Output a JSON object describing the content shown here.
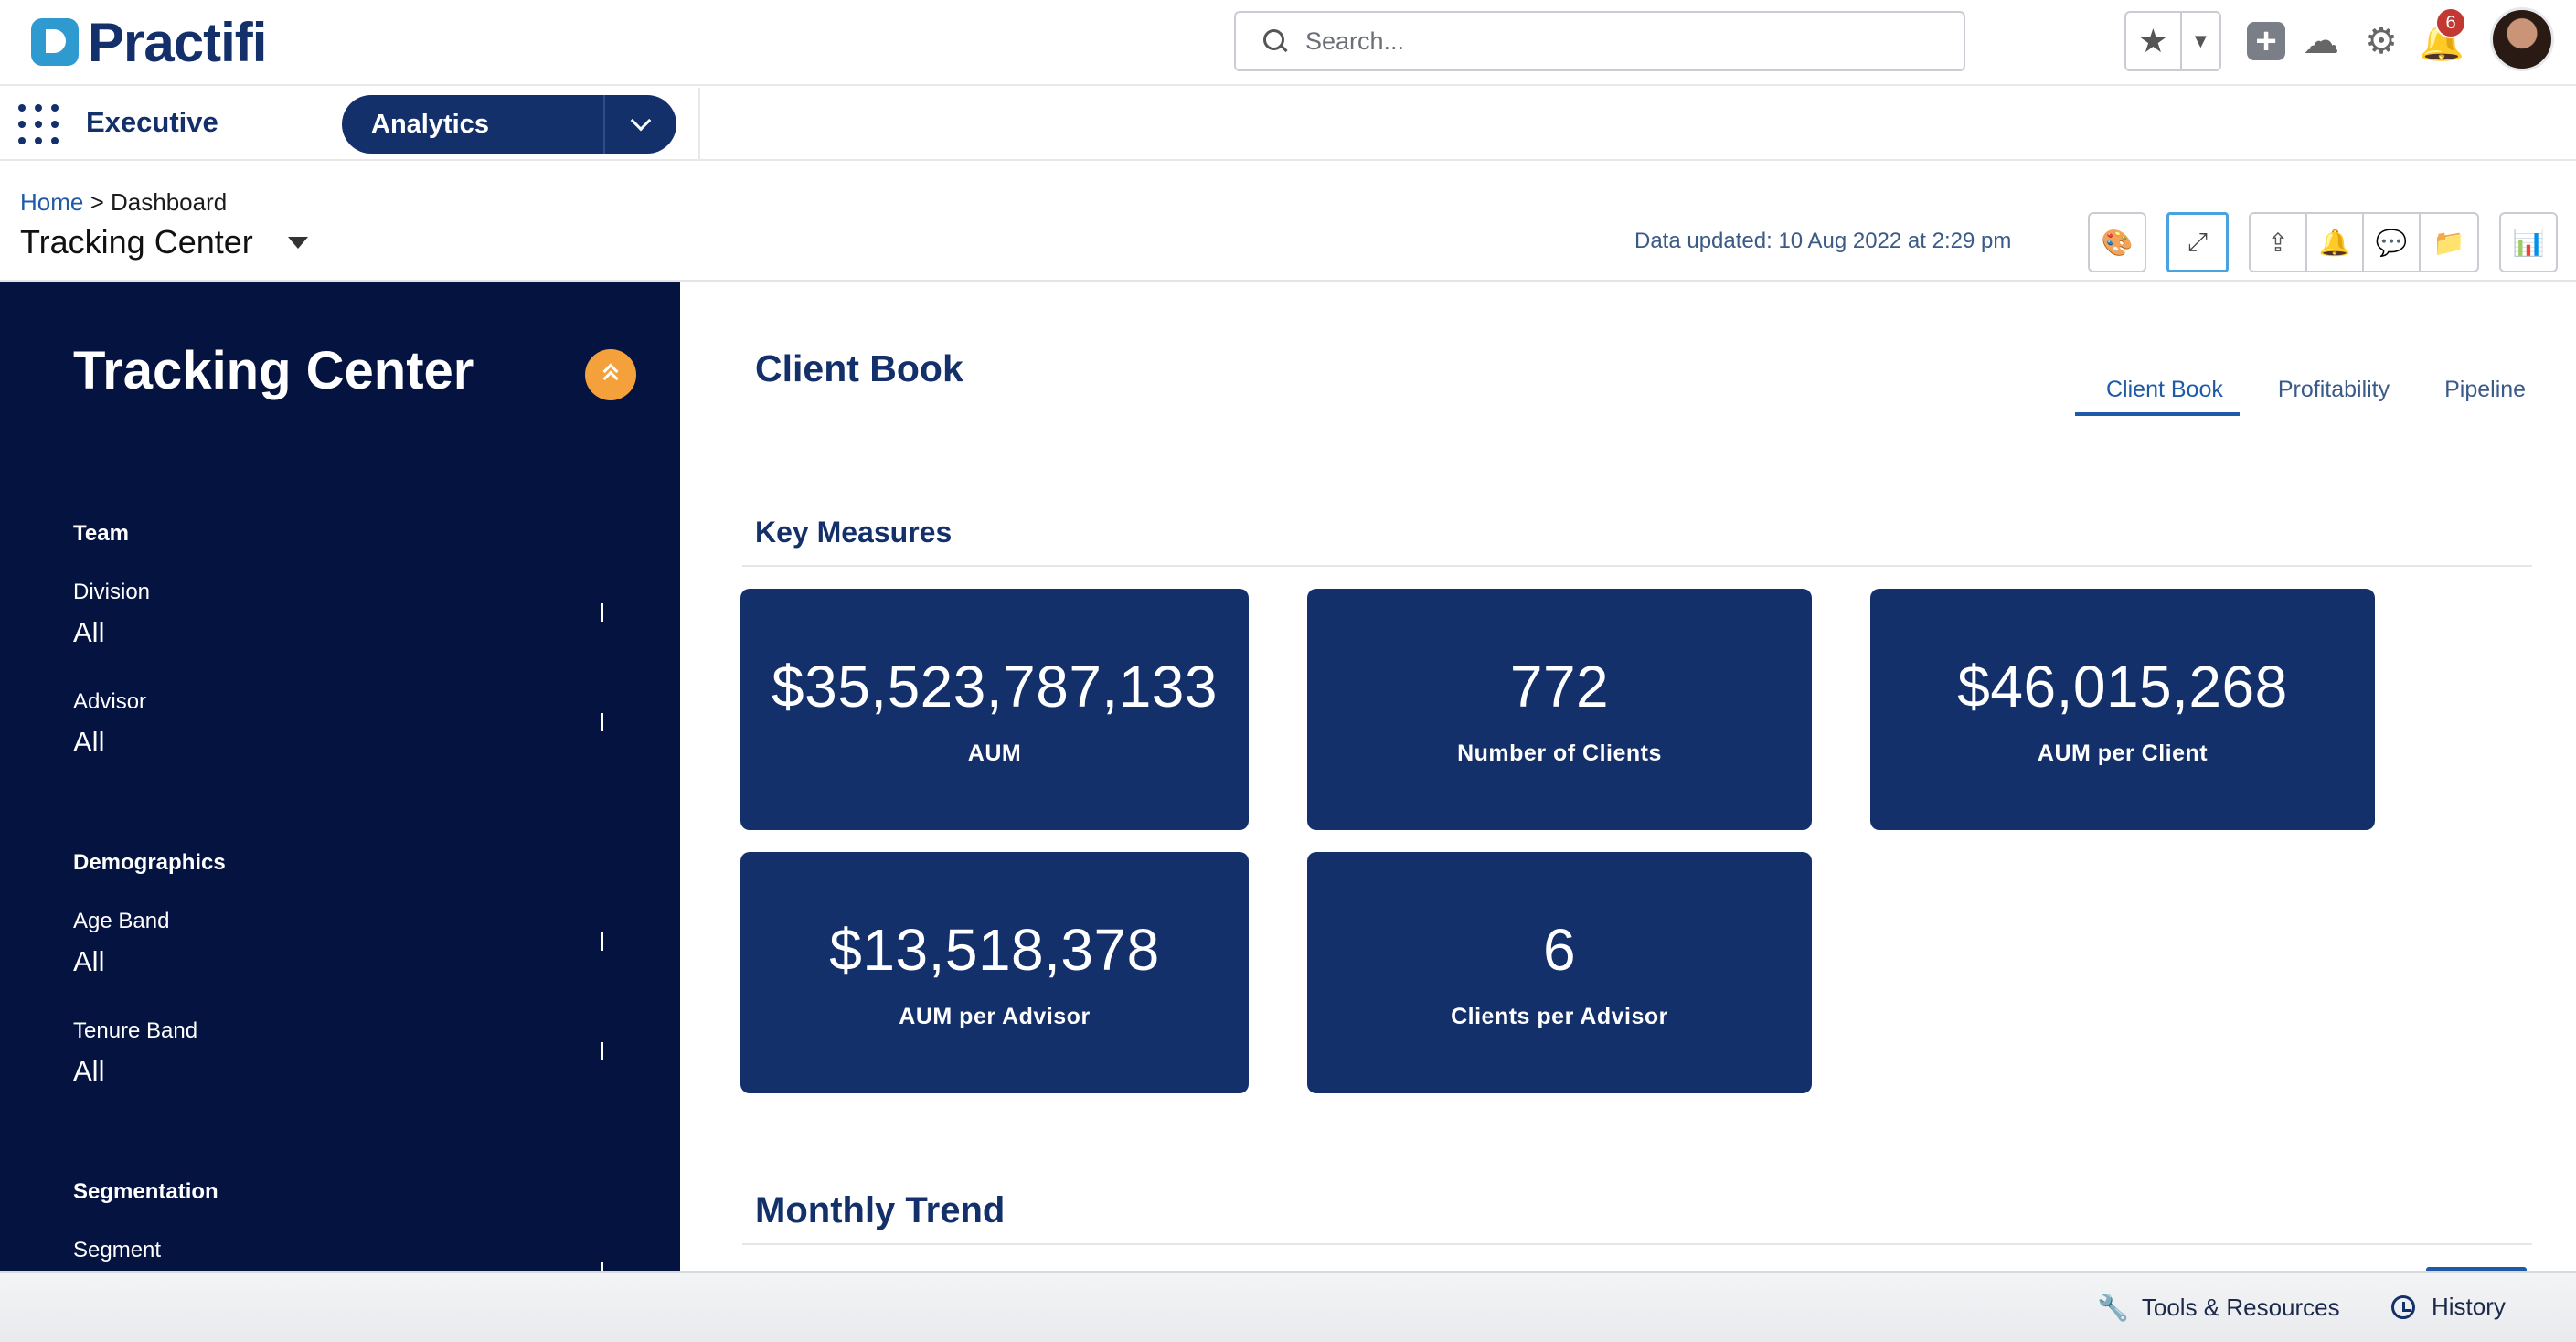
{
  "header": {
    "logo_text": "Practifi",
    "search_placeholder": "Search...",
    "notification_count": "6"
  },
  "nav": {
    "app_name": "Executive",
    "tab_label": "Analytics"
  },
  "page": {
    "breadcrumb_home": "Home",
    "breadcrumb_separator": ">",
    "breadcrumb_current": "Dashboard",
    "title": "Tracking Center",
    "data_updated": "Data updated: 10 Aug 2022 at 2:29 pm"
  },
  "sidebar": {
    "title": "Tracking Center",
    "sections": [
      {
        "title": "Team",
        "filters": [
          {
            "label": "Division",
            "value": "All"
          },
          {
            "label": "Advisor",
            "value": "All"
          }
        ]
      },
      {
        "title": "Demographics",
        "filters": [
          {
            "label": "Age Band",
            "value": "All"
          },
          {
            "label": "Tenure Band",
            "value": "All"
          }
        ]
      },
      {
        "title": "Segmentation",
        "filters": [
          {
            "label": "Segment",
            "value": ""
          }
        ]
      }
    ]
  },
  "main": {
    "section_title": "Client Book",
    "tabs": [
      "Client Book",
      "Profitability",
      "Pipeline"
    ],
    "active_tab": "Client Book",
    "key_measures_title": "Key Measures",
    "cards": [
      {
        "value": "$35,523,787,133",
        "label": "AUM"
      },
      {
        "value": "772",
        "label": "Number of Clients"
      },
      {
        "value": "$46,015,268",
        "label": "AUM per Client"
      },
      {
        "value": "$13,518,378",
        "label": "AUM per Advisor"
      },
      {
        "value": "6",
        "label": "Clients per Advisor"
      }
    ],
    "trend_title": "Monthly Trend"
  },
  "footer": {
    "tools_label": "Tools & Resources",
    "history_label": "History"
  },
  "colors": {
    "brand_navy": "#13306b",
    "sidebar_bg": "#04133f",
    "accent_orange": "#f5a13b",
    "link_blue": "#1f5aa8",
    "badge_red": "#c23934"
  }
}
